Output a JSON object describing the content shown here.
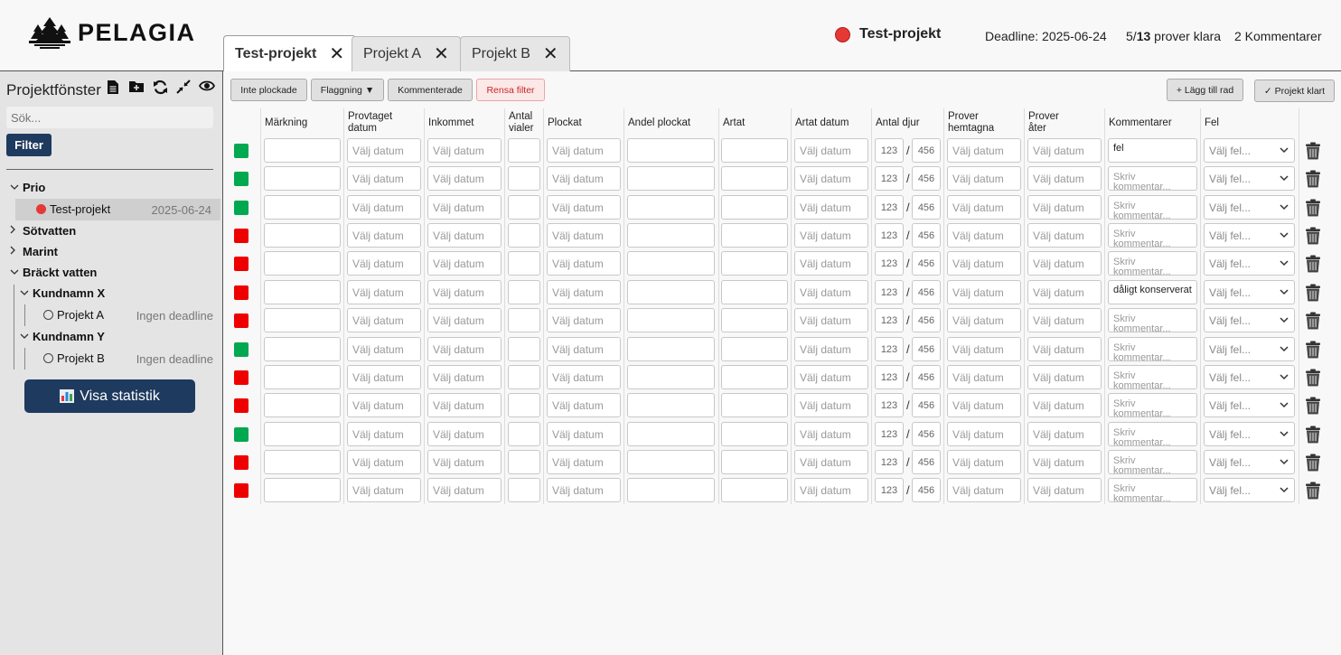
{
  "app": {
    "logo_text": "PELAGIA"
  },
  "tabs": [
    {
      "label": "Test-projekt",
      "close": "✕"
    },
    {
      "label": "Projekt A",
      "close": "✕"
    },
    {
      "label": "Projekt B",
      "close": "✕"
    }
  ],
  "header": {
    "project_name": "Test-projekt",
    "deadline": "Deadline: 2025-06-24",
    "samples_done": "5",
    "samples_total": "13",
    "samples_suffix": " prover klara",
    "samples_sep": "/",
    "comments": "2 Kommentarer"
  },
  "sidebar": {
    "title": "Projektfönster",
    "search_placeholder": "Sök...",
    "filter_label": "Filter",
    "tree": {
      "prio": "Prio",
      "test_project": "Test-projekt",
      "test_project_date": "2025-06-24",
      "sotvatten": "Sötvatten",
      "marint": "Marint",
      "brackt": "Bräckt vatten",
      "kund_x": "Kundnamn X",
      "projekt_a": "Projekt A",
      "projekt_a_date": "Ingen deadline",
      "kund_y": "Kundnamn Y",
      "projekt_b": "Projekt B",
      "projekt_b_date": "Ingen deadline"
    },
    "stats_label": "Visa statistik"
  },
  "toolbar": {
    "inte_plockade": "Inte plockade",
    "flaggning": "Flaggning ▼",
    "kommenterade": "Kommenterade",
    "rensa": "Rensa filter",
    "add_row": "+ Lägg till rad",
    "project_done": "✓ Projekt klart"
  },
  "columns": [
    "Märkning",
    "Provtaget datum",
    "Inkommet",
    "Antal vialer",
    "Plockat",
    "Andel plockat",
    "Artat",
    "Artat datum",
    "Antal djur",
    "Prover hemtagna",
    "Prover åter",
    "Kommentarer",
    "Fel"
  ],
  "placeholders": {
    "date": "Välj datum",
    "num1": "123",
    "num2": "456",
    "comment": "Skriv kommentar...",
    "error": "Välj fel..."
  },
  "colors": {
    "green": "#00a84f",
    "red": "#ee0000",
    "navy": "#1e3a5f"
  },
  "rows": [
    {
      "status": "green",
      "comment": "fel"
    },
    {
      "status": "green",
      "comment": ""
    },
    {
      "status": "green",
      "comment": ""
    },
    {
      "status": "red",
      "comment": ""
    },
    {
      "status": "red",
      "comment": ""
    },
    {
      "status": "red",
      "comment": "dåligt konserverat"
    },
    {
      "status": "red",
      "comment": ""
    },
    {
      "status": "green",
      "comment": ""
    },
    {
      "status": "red",
      "comment": ""
    },
    {
      "status": "red",
      "comment": ""
    },
    {
      "status": "green",
      "comment": ""
    },
    {
      "status": "red",
      "comment": ""
    },
    {
      "status": "red",
      "comment": ""
    }
  ]
}
